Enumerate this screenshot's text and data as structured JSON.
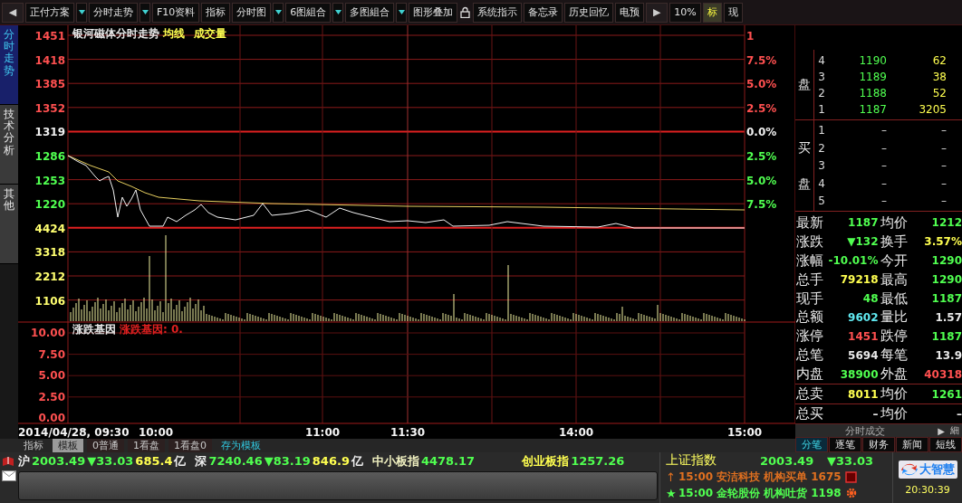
{
  "toolbar": [
    {
      "kind": "arrow",
      "label": "◀"
    },
    {
      "kind": "button",
      "label": "正付方案",
      "dropdown": true,
      "selected": false
    },
    {
      "kind": "button",
      "label": "分时走势",
      "dropdown": true,
      "selected": false
    },
    {
      "kind": "button",
      "label": "F10资料",
      "dropdown": false,
      "selected": false
    },
    {
      "kind": "button",
      "label": "指标",
      "dropdown": false,
      "selected": false
    },
    {
      "kind": "button",
      "label": "分时图",
      "dropdown": true,
      "selected": false
    },
    {
      "kind": "button",
      "label": "6图組合",
      "dropdown": true,
      "selected": false
    },
    {
      "kind": "button",
      "label": "多图組合",
      "dropdown": true,
      "selected": false
    },
    {
      "kind": "button",
      "label": "图形叠加",
      "dropdown": false,
      "selected": false
    },
    {
      "kind": "lock"
    },
    {
      "kind": "button",
      "label": "系统指示",
      "dropdown": false,
      "selected": false
    },
    {
      "kind": "button",
      "label": "备忘录",
      "dropdown": false,
      "selected": false
    },
    {
      "kind": "button",
      "label": "历史回忆",
      "dropdown": false,
      "selected": false
    },
    {
      "kind": "button",
      "label": "电预",
      "dropdown": false,
      "selected": false
    },
    {
      "kind": "arrow",
      "label": "▶"
    },
    {
      "kind": "button",
      "label": "10%",
      "dropdown": false,
      "selected": false
    },
    {
      "kind": "button",
      "label": "标",
      "dropdown": false,
      "selected": true
    },
    {
      "kind": "button",
      "label": "现",
      "dropdown": false,
      "selected": false
    }
  ],
  "side_tabs": [
    {
      "label": "分时走势",
      "selected": true
    },
    {
      "label": "技术分析",
      "selected": false
    },
    {
      "label": "其他",
      "selected": false
    }
  ],
  "chart": {
    "titles": [
      {
        "text": "银河磁体分时走势",
        "color": "#e8e8e8"
      },
      {
        "text": "均线",
        "color": "#ffff50"
      },
      {
        "text": "成交量",
        "color": "#ffff50"
      }
    ],
    "price_labels": [
      {
        "text": "1451",
        "color": "#ff5050"
      },
      {
        "text": "1418",
        "color": "#ff5050"
      },
      {
        "text": "1385",
        "color": "#ff5050"
      },
      {
        "text": "1352",
        "color": "#ff5050"
      },
      {
        "text": "1319",
        "color": "#f0f0f0"
      },
      {
        "text": "1286",
        "color": "#50ff50"
      },
      {
        "text": "1253",
        "color": "#50ff50"
      },
      {
        "text": "1220",
        "color": "#50ff50"
      }
    ],
    "volume_labels": [
      "4424",
      "3318",
      "2212",
      "1106"
    ],
    "percent_labels": [
      {
        "text": "1",
        "color": "#ff5050"
      },
      {
        "text": "7.5%",
        "color": "#ff5050"
      },
      {
        "text": "5.0%",
        "color": "#ff5050"
      },
      {
        "text": "2.5%",
        "color": "#ff5050"
      },
      {
        "text": "0.0%",
        "color": "#f0f0f0"
      },
      {
        "text": "2.5%",
        "color": "#50ff50"
      },
      {
        "text": "5.0%",
        "color": "#50ff50"
      },
      {
        "text": "7.5%",
        "color": "#50ff50"
      }
    ],
    "lower_titles": [
      {
        "text": "涨跌基因",
        "color": "#e8e8e8"
      },
      {
        "text": "涨跌基因: 0.",
        "color": "#e02020"
      }
    ],
    "lower_labels": [
      "10.00",
      "7.50",
      "5.00",
      "2.50",
      "0.00"
    ],
    "time_labels": [
      "2014/04/28, 09:30",
      "10:00",
      "11:00",
      "11:30",
      "14:00",
      "15:00"
    ]
  },
  "bottom_tabs": [
    {
      "kind": "label",
      "label": "指标",
      "selected": false
    },
    {
      "kind": "tab",
      "label": "模板",
      "selected": true
    },
    {
      "kind": "tab",
      "label": "0普通",
      "selected": false
    },
    {
      "kind": "tab",
      "label": "1看盘",
      "selected": false
    },
    {
      "kind": "tab",
      "label": "1看盘0",
      "selected": false
    },
    {
      "kind": "link",
      "label": "存为模板",
      "selected": false
    }
  ],
  "order_book": {
    "sell": {
      "label": "盘",
      "rows": [
        {
          "level": "4",
          "price": "1190",
          "volume": "62"
        },
        {
          "level": "3",
          "price": "1189",
          "volume": "38"
        },
        {
          "level": "2",
          "price": "1188",
          "volume": "52"
        },
        {
          "level": "1",
          "price": "1187",
          "volume": "3205"
        }
      ]
    },
    "buy": {
      "label": "买盘",
      "rows": [
        {
          "level": "1",
          "price": "–",
          "volume": "–"
        },
        {
          "level": "2",
          "price": "–",
          "volume": "–"
        },
        {
          "level": "3",
          "price": "–",
          "volume": "–"
        },
        {
          "level": "4",
          "price": "–",
          "volume": "–"
        },
        {
          "level": "5",
          "price": "–",
          "volume": "–"
        }
      ]
    }
  },
  "stats": [
    [
      {
        "label": "最新",
        "value": "1187",
        "color": "#50ff50"
      },
      {
        "label": "均价",
        "value": "1212",
        "color": "#50ff50"
      }
    ],
    [
      {
        "label": "涨跌",
        "value": "▼132",
        "color": "#50ff50"
      },
      {
        "label": "换手",
        "value": "3.57%",
        "color": "#ffff50"
      }
    ],
    [
      {
        "label": "涨幅",
        "value": "-10.01%",
        "color": "#50ff50"
      },
      {
        "label": "今开",
        "value": "1290",
        "color": "#50ff50"
      }
    ],
    [
      {
        "label": "总手",
        "value": "79218",
        "color": "#ffff50"
      },
      {
        "label": "最高",
        "value": "1290",
        "color": "#50ff50"
      }
    ],
    [
      {
        "label": "现手",
        "value": "48",
        "color": "#50ff50"
      },
      {
        "label": "最低",
        "value": "1187",
        "color": "#50ff50"
      }
    ],
    [
      {
        "label": "总额",
        "value": "9602",
        "color": "#60e8f0"
      },
      {
        "label": "量比",
        "value": "1.57",
        "color": "#e8e8e8"
      }
    ],
    [
      {
        "label": "涨停",
        "value": "1451",
        "color": "#ff5050"
      },
      {
        "label": "跌停",
        "value": "1187",
        "color": "#50ff50"
      }
    ],
    [
      {
        "label": "总笔",
        "value": "5694",
        "color": "#e8e8e8"
      },
      {
        "label": "每笔",
        "value": "13.9",
        "color": "#e8e8e8"
      }
    ],
    [
      {
        "label": "内盘",
        "value": "38900",
        "color": "#50ff50"
      },
      {
        "label": "外盘",
        "value": "40318",
        "color": "#ff5050"
      }
    ],
    [
      {
        "label": "总卖",
        "value": "8011",
        "color": "#ffff50"
      },
      {
        "label": "均价",
        "value": "1261",
        "color": "#50ff50"
      }
    ],
    [
      {
        "label": "总买",
        "value": "–",
        "color": "#e8e8e8"
      },
      {
        "label": "均价",
        "value": "–",
        "color": "#e8e8e8"
      }
    ]
  ],
  "trades_bar": {
    "title": "分时成交",
    "arrow": "▶",
    "detail": "細"
  },
  "right_tabs": [
    {
      "label": "分笔",
      "selected": true
    },
    {
      "label": "逐笔",
      "selected": false
    },
    {
      "label": "财务",
      "selected": false
    },
    {
      "label": "新闻",
      "selected": false
    },
    {
      "label": "短线",
      "selected": false
    }
  ],
  "ticker": [
    {
      "text": "沪",
      "color": "#f0f0f0"
    },
    {
      "text": "2003.49",
      "color": "#50ff50"
    },
    {
      "text": "▼33.03",
      "color": "#50ff50"
    },
    {
      "text": "685.4",
      "color": "#ffff50"
    },
    {
      "text": "亿",
      "color": "#f0f0f0"
    },
    {
      "text": "深",
      "color": "#f0f0f0"
    },
    {
      "text": "7240.46",
      "color": "#50ff50"
    },
    {
      "text": "▼83.19",
      "color": "#50ff50"
    },
    {
      "text": "846.9",
      "color": "#ffff50"
    },
    {
      "text": "亿",
      "color": "#f0f0f0"
    },
    {
      "text": "中小板指",
      "color": "#f0f0c0"
    },
    {
      "text": "4478.17",
      "color": "#50ff50"
    },
    {
      "text": "创业板指",
      "color": "#ffff50"
    },
    {
      "text": "1257.26",
      "color": "#50ff50"
    }
  ],
  "index_line": {
    "name": "上证指数",
    "value": "2003.49",
    "change": "▼33.03"
  },
  "news": [
    {
      "mark": "↑",
      "time": "15:00",
      "stock": "安洁科技",
      "event": "机构买单",
      "price": "1675",
      "color": "#e07020"
    },
    {
      "mark": "★",
      "time": "15:00",
      "stock": "金轮股份",
      "event": "机构吐货",
      "price": "1198",
      "color": "#50ff50"
    }
  ],
  "logo": {
    "text": "大智慧"
  },
  "clock": "20:30:39"
}
